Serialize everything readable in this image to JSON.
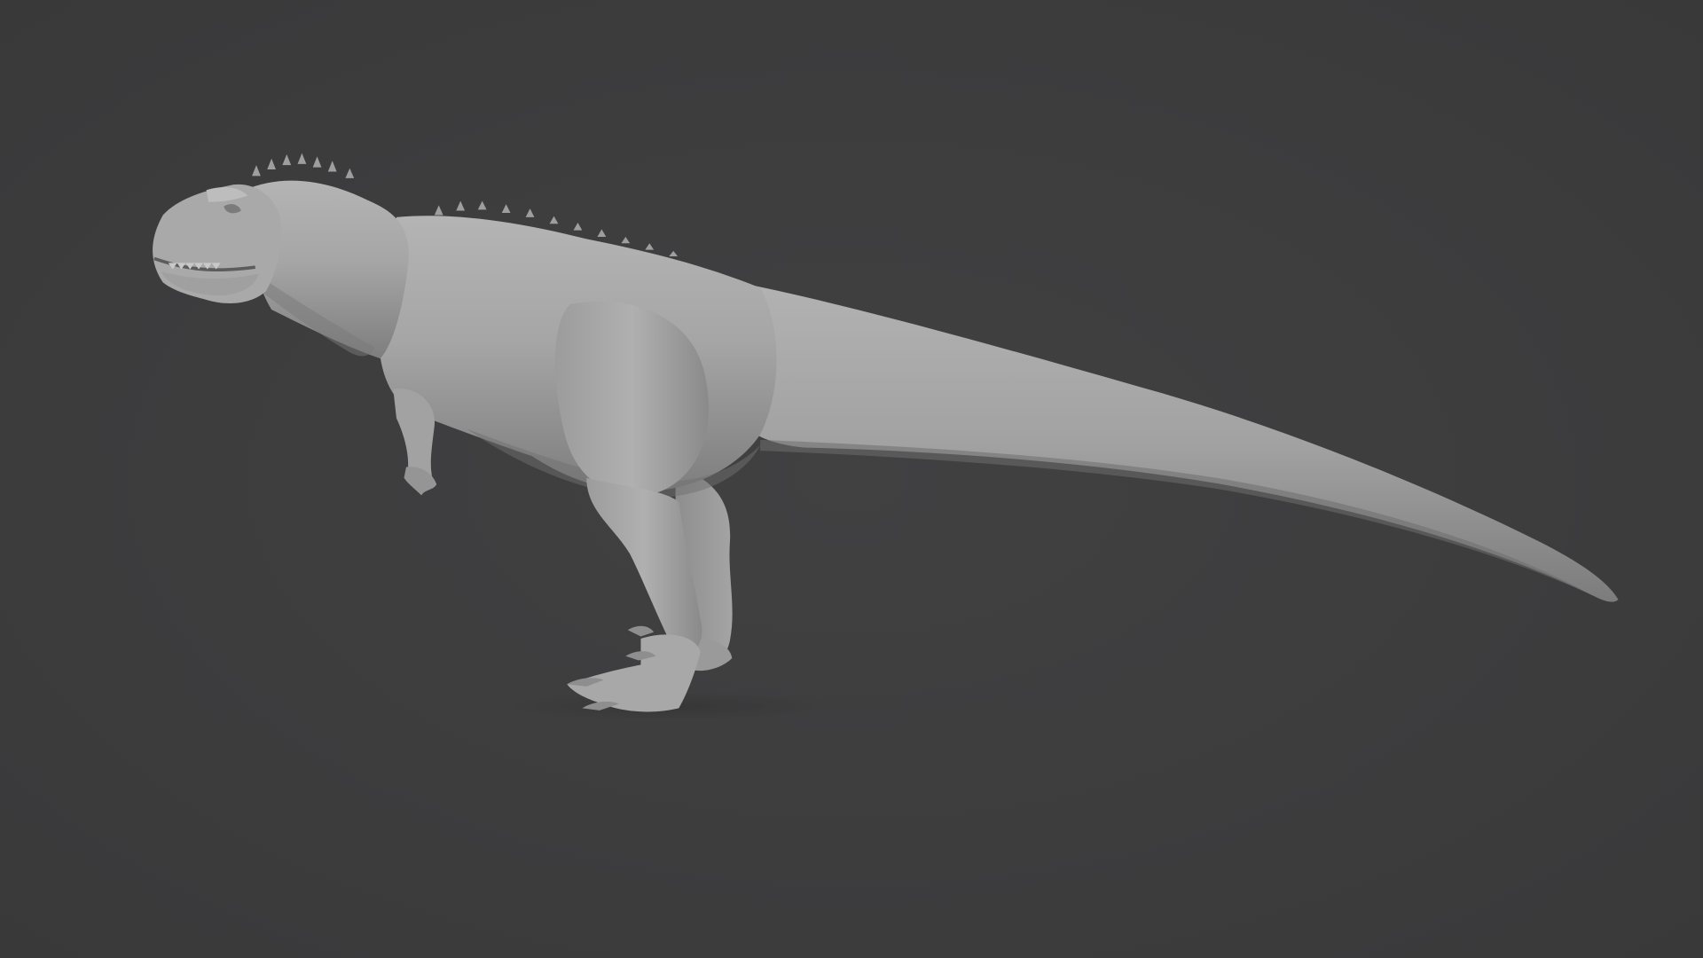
{
  "viewport": {
    "background_color": "#3d3d3e",
    "model_color": "#a8a8a8"
  }
}
